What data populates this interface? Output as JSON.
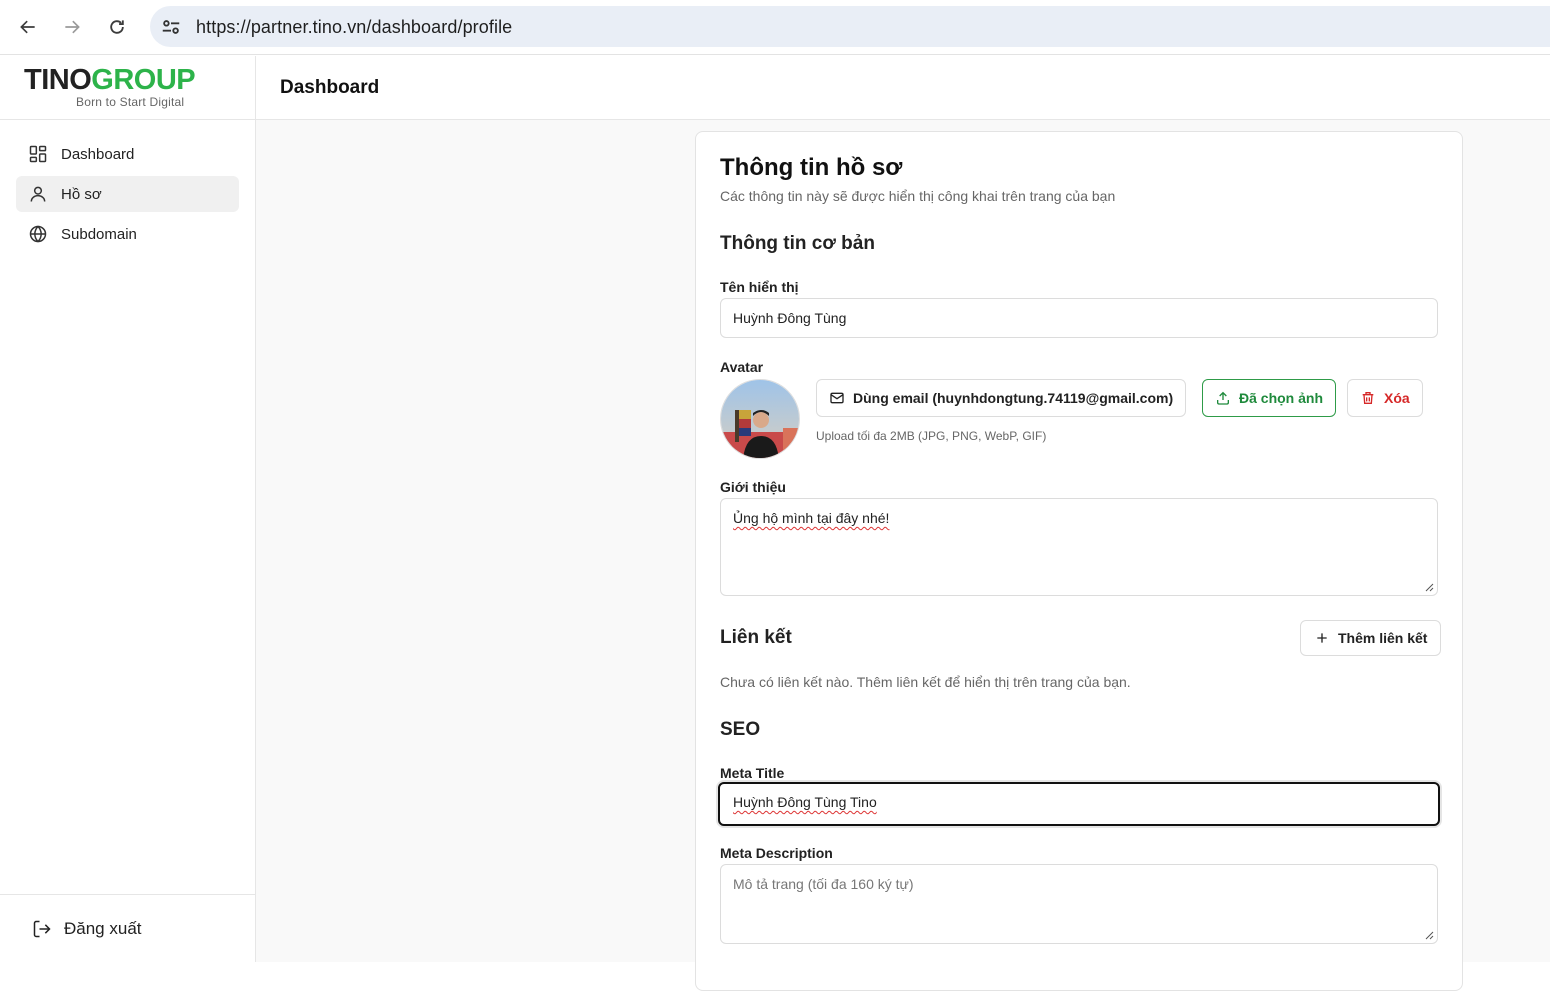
{
  "browser": {
    "url": "https://partner.tino.vn/dashboard/profile"
  },
  "brand": {
    "logo_part1": "TINO",
    "logo_part2": "GROUP",
    "tagline": "Born to Start Digital",
    "accent": "#2db34a"
  },
  "sidebar": {
    "items": [
      {
        "label": "Dashboard",
        "icon": "grid-icon"
      },
      {
        "label": "Hồ sơ",
        "icon": "user-icon"
      },
      {
        "label": "Subdomain",
        "icon": "globe-icon"
      }
    ],
    "logout_label": "Đăng xuất"
  },
  "header": {
    "title": "Dashboard"
  },
  "profile": {
    "title": "Thông tin hồ sơ",
    "description": "Các thông tin này sẽ được hiển thị công khai trên trang của bạn",
    "basic_section": "Thông tin cơ bản",
    "display_name_label": "Tên hiển thị",
    "display_name_value": "Huỳnh Đông Tùng",
    "avatar_label": "Avatar",
    "use_email_button": "Dùng email (huynhdongtung.74119@gmail.com)",
    "chosen_button": "Đã chọn ảnh",
    "delete_button": "Xóa",
    "upload_hint": "Upload tối đa 2MB (JPG, PNG, WebP, GIF)",
    "bio_label": "Giới thiệu",
    "bio_value": "Ủng hộ mình tại đây nhé!",
    "links_section": "Liên kết",
    "add_link_button": "Thêm liên kết",
    "links_empty": "Chưa có liên kết nào. Thêm liên kết để hiển thị trên trang của bạn.",
    "seo_section": "SEO",
    "meta_title_label": "Meta Title",
    "meta_title_value": "Huỳnh Đông Tùng Tino",
    "meta_desc_label": "Meta Description",
    "meta_desc_placeholder": "Mô tả trang (tối đa 160 ký tự)"
  }
}
